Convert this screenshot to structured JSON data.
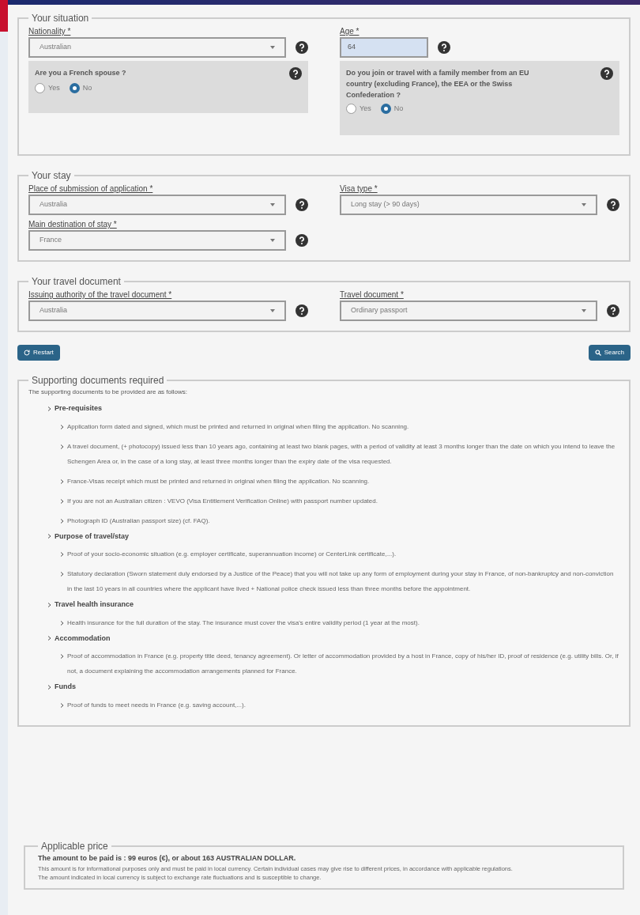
{
  "situation": {
    "legend": "Your situation",
    "nationality": {
      "label": "Nationality *",
      "value": "Australian"
    },
    "age": {
      "label": "Age *",
      "value": "64"
    },
    "questions": [
      {
        "text": "Are you a French spouse ?",
        "options": [
          {
            "label": "Yes",
            "selected": false
          },
          {
            "label": "No",
            "selected": true
          }
        ]
      },
      {
        "text": "Do you join or travel with a family member from an EU country (excluding France), the EEA or the Swiss Confederation ?",
        "options": [
          {
            "label": "Yes",
            "selected": false
          },
          {
            "label": "No",
            "selected": true
          }
        ]
      }
    ]
  },
  "stay": {
    "legend": "Your stay",
    "fields": [
      {
        "label": "Place of submission of application *",
        "value": "Australia"
      },
      {
        "label": "Visa type *",
        "value": "Long stay (> 90 days)"
      },
      {
        "label": "Main destination of stay *",
        "value": "France"
      }
    ]
  },
  "travel_document": {
    "legend": "Your travel document",
    "fields": [
      {
        "label": "Issuing authority of the travel document *",
        "value": "Australia"
      },
      {
        "label": "Travel document *",
        "value": "Ordinary passport"
      }
    ]
  },
  "buttons": {
    "restart": "Restart",
    "search": "Search"
  },
  "documents": {
    "legend": "Supporting documents required",
    "intro": "The supporting documents to be provided are as follows:",
    "sections": [
      {
        "title": "Pre-requisites",
        "items": [
          "Application form dated and signed, which must be printed and returned in original when filing the application. No scanning.",
          "A travel document, (+ photocopy) issued less than 10 years ago, containing at least two blank pages, with a period of validity at least 3 months longer than the date on which you intend to leave the Schengen Area or, in the case of a long stay, at least three months longer than the expiry date of the visa requested.",
          "France-Visas receipt which must be printed and returned in original when filing the application. No scanning.",
          "If you are not an Australian citizen : VEVO (Visa Entitlement Verification Online) with passport number updated.",
          "Photograph ID (Australian passport size) (cf. FAQ)."
        ]
      },
      {
        "title": "Purpose of travel/stay",
        "items": [
          "Proof of your socio-economic situation (e.g. employer certificate, superannuation income) or CenterLink certificate,...).",
          "Statutory declaration (Sworn statement duly endorsed by a Justice of the Peace) that you will not take up any form of employment during your stay in France, of non-bankruptcy and non-conviction in the last 10 years in all countries where the applicant have lived + National police check issued less than three months before the appointment."
        ]
      },
      {
        "title": "Travel health insurance",
        "items": [
          "Health insurance for the full duration of the stay. The insurance must cover the visa's entire validity period (1 year at the most)."
        ]
      },
      {
        "title": "Accommodation",
        "items": [
          "Proof of accommodation in France (e.g. property title deed, tenancy agreement). Or letter of accommodation provided by a host in France, copy of his/her ID, proof of residence (e.g. utility bills. Or, if not, a document explaining the accommodation arrangements planned for France."
        ]
      },
      {
        "title": "Funds",
        "items": [
          "Proof of funds to meet needs in France (e.g. saving account,...)."
        ]
      }
    ]
  },
  "price": {
    "legend": "Applicable price",
    "amount": "The amount to be paid is : 99 euros (€), or about 163 AUSTRALIAN DOLLAR.",
    "notes": [
      "This amount is for informational purposes only and must be paid in local currency. Certain individual cases may give rise to different prices, in accordance with applicable regulations.",
      "The amount indicated in local currency is subject to exchange rate fluctuations and is susceptible to change."
    ]
  }
}
